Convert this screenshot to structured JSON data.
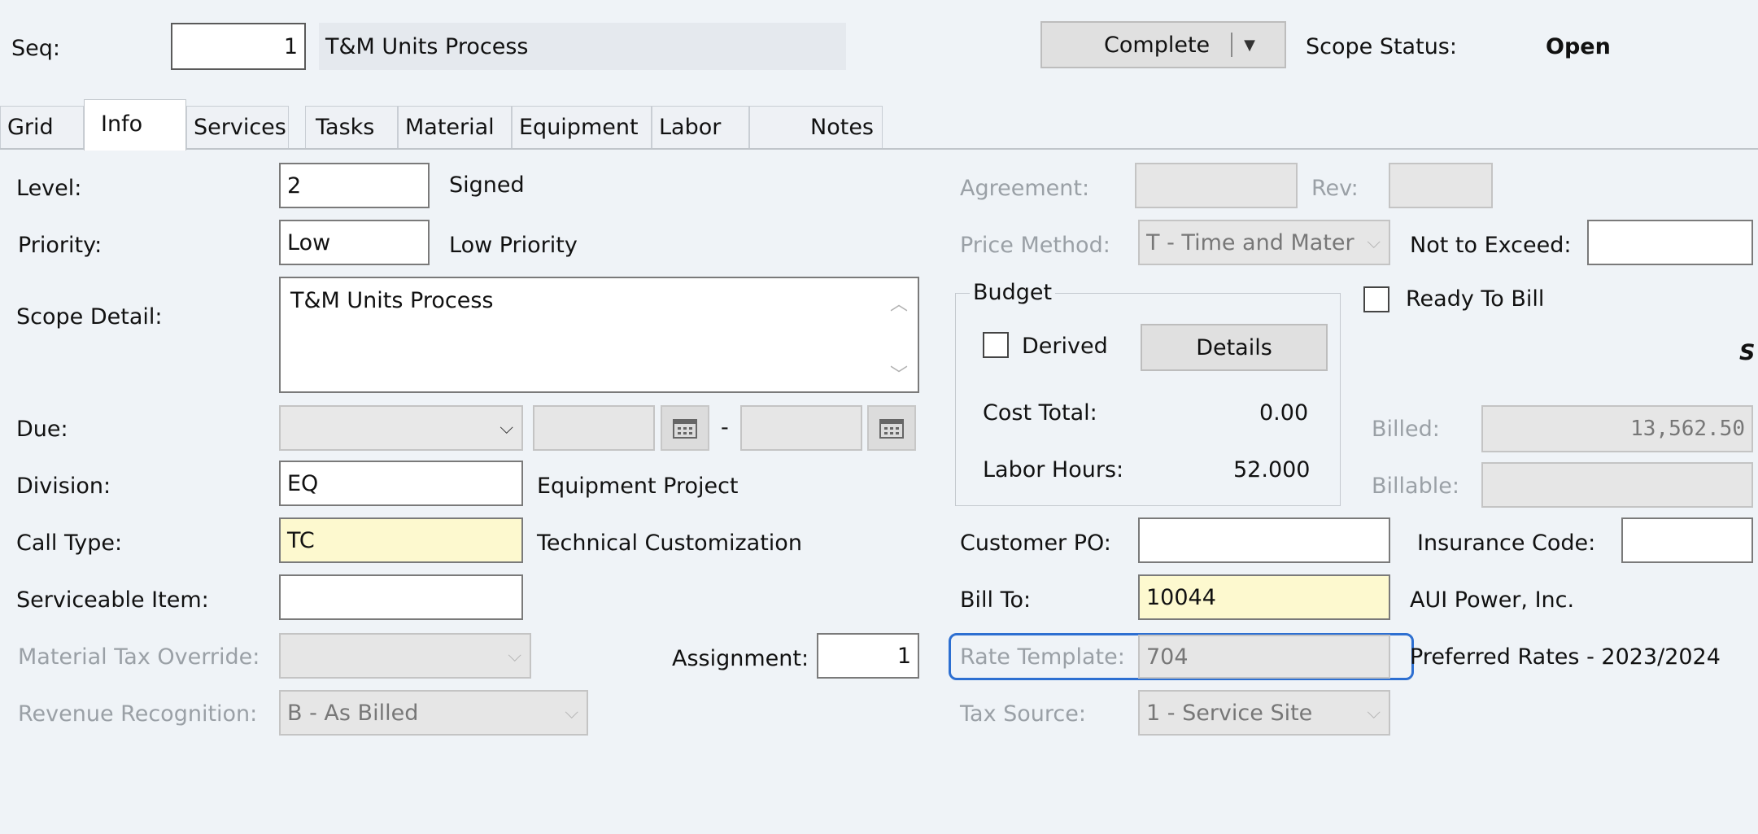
{
  "header": {
    "seq_label": "Seq:",
    "seq_value": "1",
    "seq_description": "T&M Units Process",
    "complete_label": "Complete",
    "scope_status_label": "Scope Status:",
    "scope_status_value": "Open"
  },
  "tabs": [
    {
      "label": "Grid"
    },
    {
      "label": "Info"
    },
    {
      "label": "Services"
    },
    {
      "label": "Tasks"
    },
    {
      "label": "Material"
    },
    {
      "label": "Equipment"
    },
    {
      "label": "Labor"
    },
    {
      "label": "Notes"
    }
  ],
  "left": {
    "level_label": "Level:",
    "level_value": "2",
    "level_desc": "Signed",
    "priority_label": "Priority:",
    "priority_value": "Low",
    "priority_desc": "Low Priority",
    "scope_detail_label": "Scope Detail:",
    "scope_detail_value": "T&M Units Process",
    "due_label": "Due:",
    "due_dash": "-",
    "division_label": "Division:",
    "division_value": "EQ",
    "division_desc": "Equipment Project",
    "call_type_label": "Call Type:",
    "call_type_value": "TC",
    "call_type_desc": "Technical Customization",
    "serviceable_item_label": "Serviceable Item:",
    "material_tax_label": "Material Tax Override:",
    "assignment_label": "Assignment:",
    "assignment_value": "1",
    "revenue_label": "Revenue Recognition:",
    "revenue_value": "B - As Billed"
  },
  "middle": {
    "agreement_label": "Agreement:",
    "rev_label": "Rev:",
    "price_method_label": "Price Method:",
    "price_method_value": "T - Time and Mater",
    "budget_label": "Budget",
    "derived_label": "Derived",
    "details_label": "Details",
    "cost_total_label": "Cost Total:",
    "cost_total_value": "0.00",
    "labor_hours_label": "Labor Hours:",
    "labor_hours_value": "52.000",
    "customer_po_label": "Customer PO:",
    "bill_to_label": "Bill To:",
    "bill_to_value": "10044",
    "rate_template_label": "Rate Template:",
    "rate_template_value": "704",
    "tax_source_label": "Tax Source:",
    "tax_source_value": "1 - Service Site"
  },
  "right": {
    "not_to_exceed_label": "Not to Exceed:",
    "ready_to_bill_label": "Ready To Bill",
    "billed_label": "Billed:",
    "billed_value": "13,562.50",
    "billable_label": "Billable:",
    "insurance_code_label": "Insurance Code:",
    "bill_to_name": "AUI Power, Inc.",
    "rate_template_name": "Preferred Rates - 2023/2024",
    "cut_text": "S"
  },
  "colors": {
    "background": "#eff3f7",
    "required_field": "#fdf9cf",
    "focus_outline": "#2d6fd1"
  }
}
